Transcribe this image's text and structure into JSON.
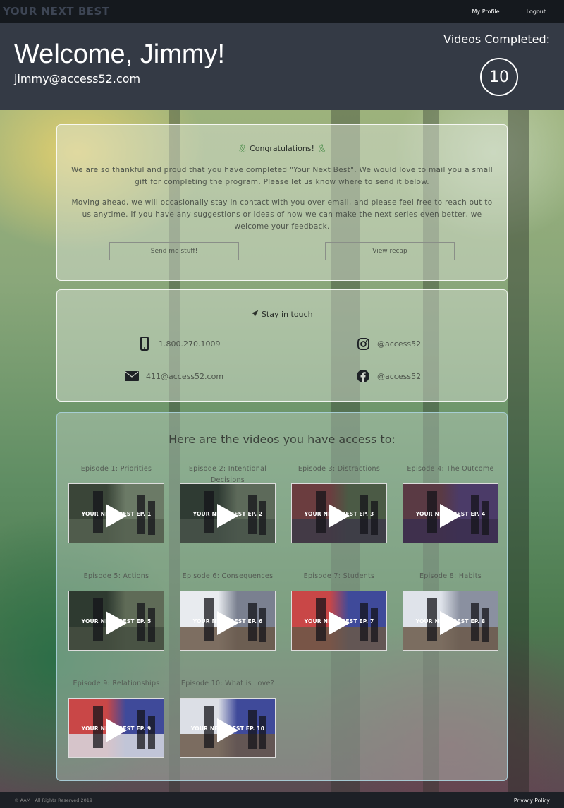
{
  "topbar": {
    "logo": "YOUR NEXT BEST",
    "nav": [
      {
        "label": "My Profile"
      },
      {
        "label": "Logout"
      }
    ]
  },
  "header": {
    "welcome": "Welcome, Jimmy!",
    "email": "jimmy@access52.com",
    "completed_label": "Videos Completed:",
    "completed_count": "10"
  },
  "congrats": {
    "title": "Congratulations!",
    "paragraph1": "We are so thankful and proud that you have completed \"Your Next Best\". We would love to mail you a small gift for completing the program. Please let us know where to send it below.",
    "paragraph2": "Moving ahead, we will occasionally stay in contact with you over email, and please feel free to reach out to us anytime. If you have any suggestions or ideas of how we can make the next series even better, we welcome your feedback.",
    "send_button": "Send me stuff!",
    "recap_button": "View recap"
  },
  "contact": {
    "title": "Stay in touch",
    "phone": "1.800.270.1009",
    "email": "411@access52.com",
    "instagram": "@access52",
    "facebook": "@access52"
  },
  "videos": {
    "title": "Here are the videos you have access to:",
    "items": [
      {
        "title": "Episode 1: Priorities",
        "thumb_label": "YOUR NEXT BEST EP. 1",
        "palette": [
          "#3a4538",
          "#6b7a66",
          "#556050"
        ]
      },
      {
        "title": "Episode 2: Intentional Decisions",
        "thumb_label": "YOUR NEXT BEST EP. 2",
        "palette": [
          "#2f3b33",
          "#5d6a5a",
          "#48534a"
        ]
      },
      {
        "title": "Episode 3: Distractions",
        "thumb_label": "YOUR NEXT BEST EP. 3",
        "palette": [
          "#6b3d3f",
          "#4b5a45",
          "#3c3948"
        ]
      },
      {
        "title": "Episode 4: The Outcome",
        "thumb_label": "YOUR NEXT BEST EP. 4",
        "palette": [
          "#5a3a44",
          "#4b3b68",
          "#3b2f4f"
        ]
      },
      {
        "title": "Episode 5: Actions",
        "thumb_label": "YOUR NEXT BEST EP. 5",
        "palette": [
          "#2e3a30",
          "#5f6b57",
          "#454f41"
        ]
      },
      {
        "title": "Episode 6: Consequences",
        "thumb_label": "YOUR NEXT BEST EP. 6",
        "palette": [
          "#e8ebef",
          "#7a8090",
          "#6a5848"
        ]
      },
      {
        "title": "Episode 7: Students",
        "thumb_label": "YOUR NEXT BEST EP. 7",
        "palette": [
          "#c94747",
          "#3f4a9a",
          "#6a5848"
        ]
      },
      {
        "title": "Episode 8: Habits",
        "thumb_label": "YOUR NEXT BEST EP. 8",
        "palette": [
          "#dfe3ea",
          "#8a90a0",
          "#6a5848"
        ]
      },
      {
        "title": "Episode 9: Relationships",
        "thumb_label": "YOUR NEXT BEST EP. 9",
        "palette": [
          "#c94747",
          "#3f4a9a",
          "#d8dbe2"
        ]
      },
      {
        "title": "Episode 10: What is Love?",
        "thumb_label": "YOUR NEXT BEST EP. 10",
        "palette": [
          "#dcdfe6",
          "#3f4a9a",
          "#6a5848"
        ]
      }
    ]
  },
  "footer": {
    "copyright": "© AAM · All Rights Reserved 2019",
    "privacy": "Privacy Policy"
  }
}
